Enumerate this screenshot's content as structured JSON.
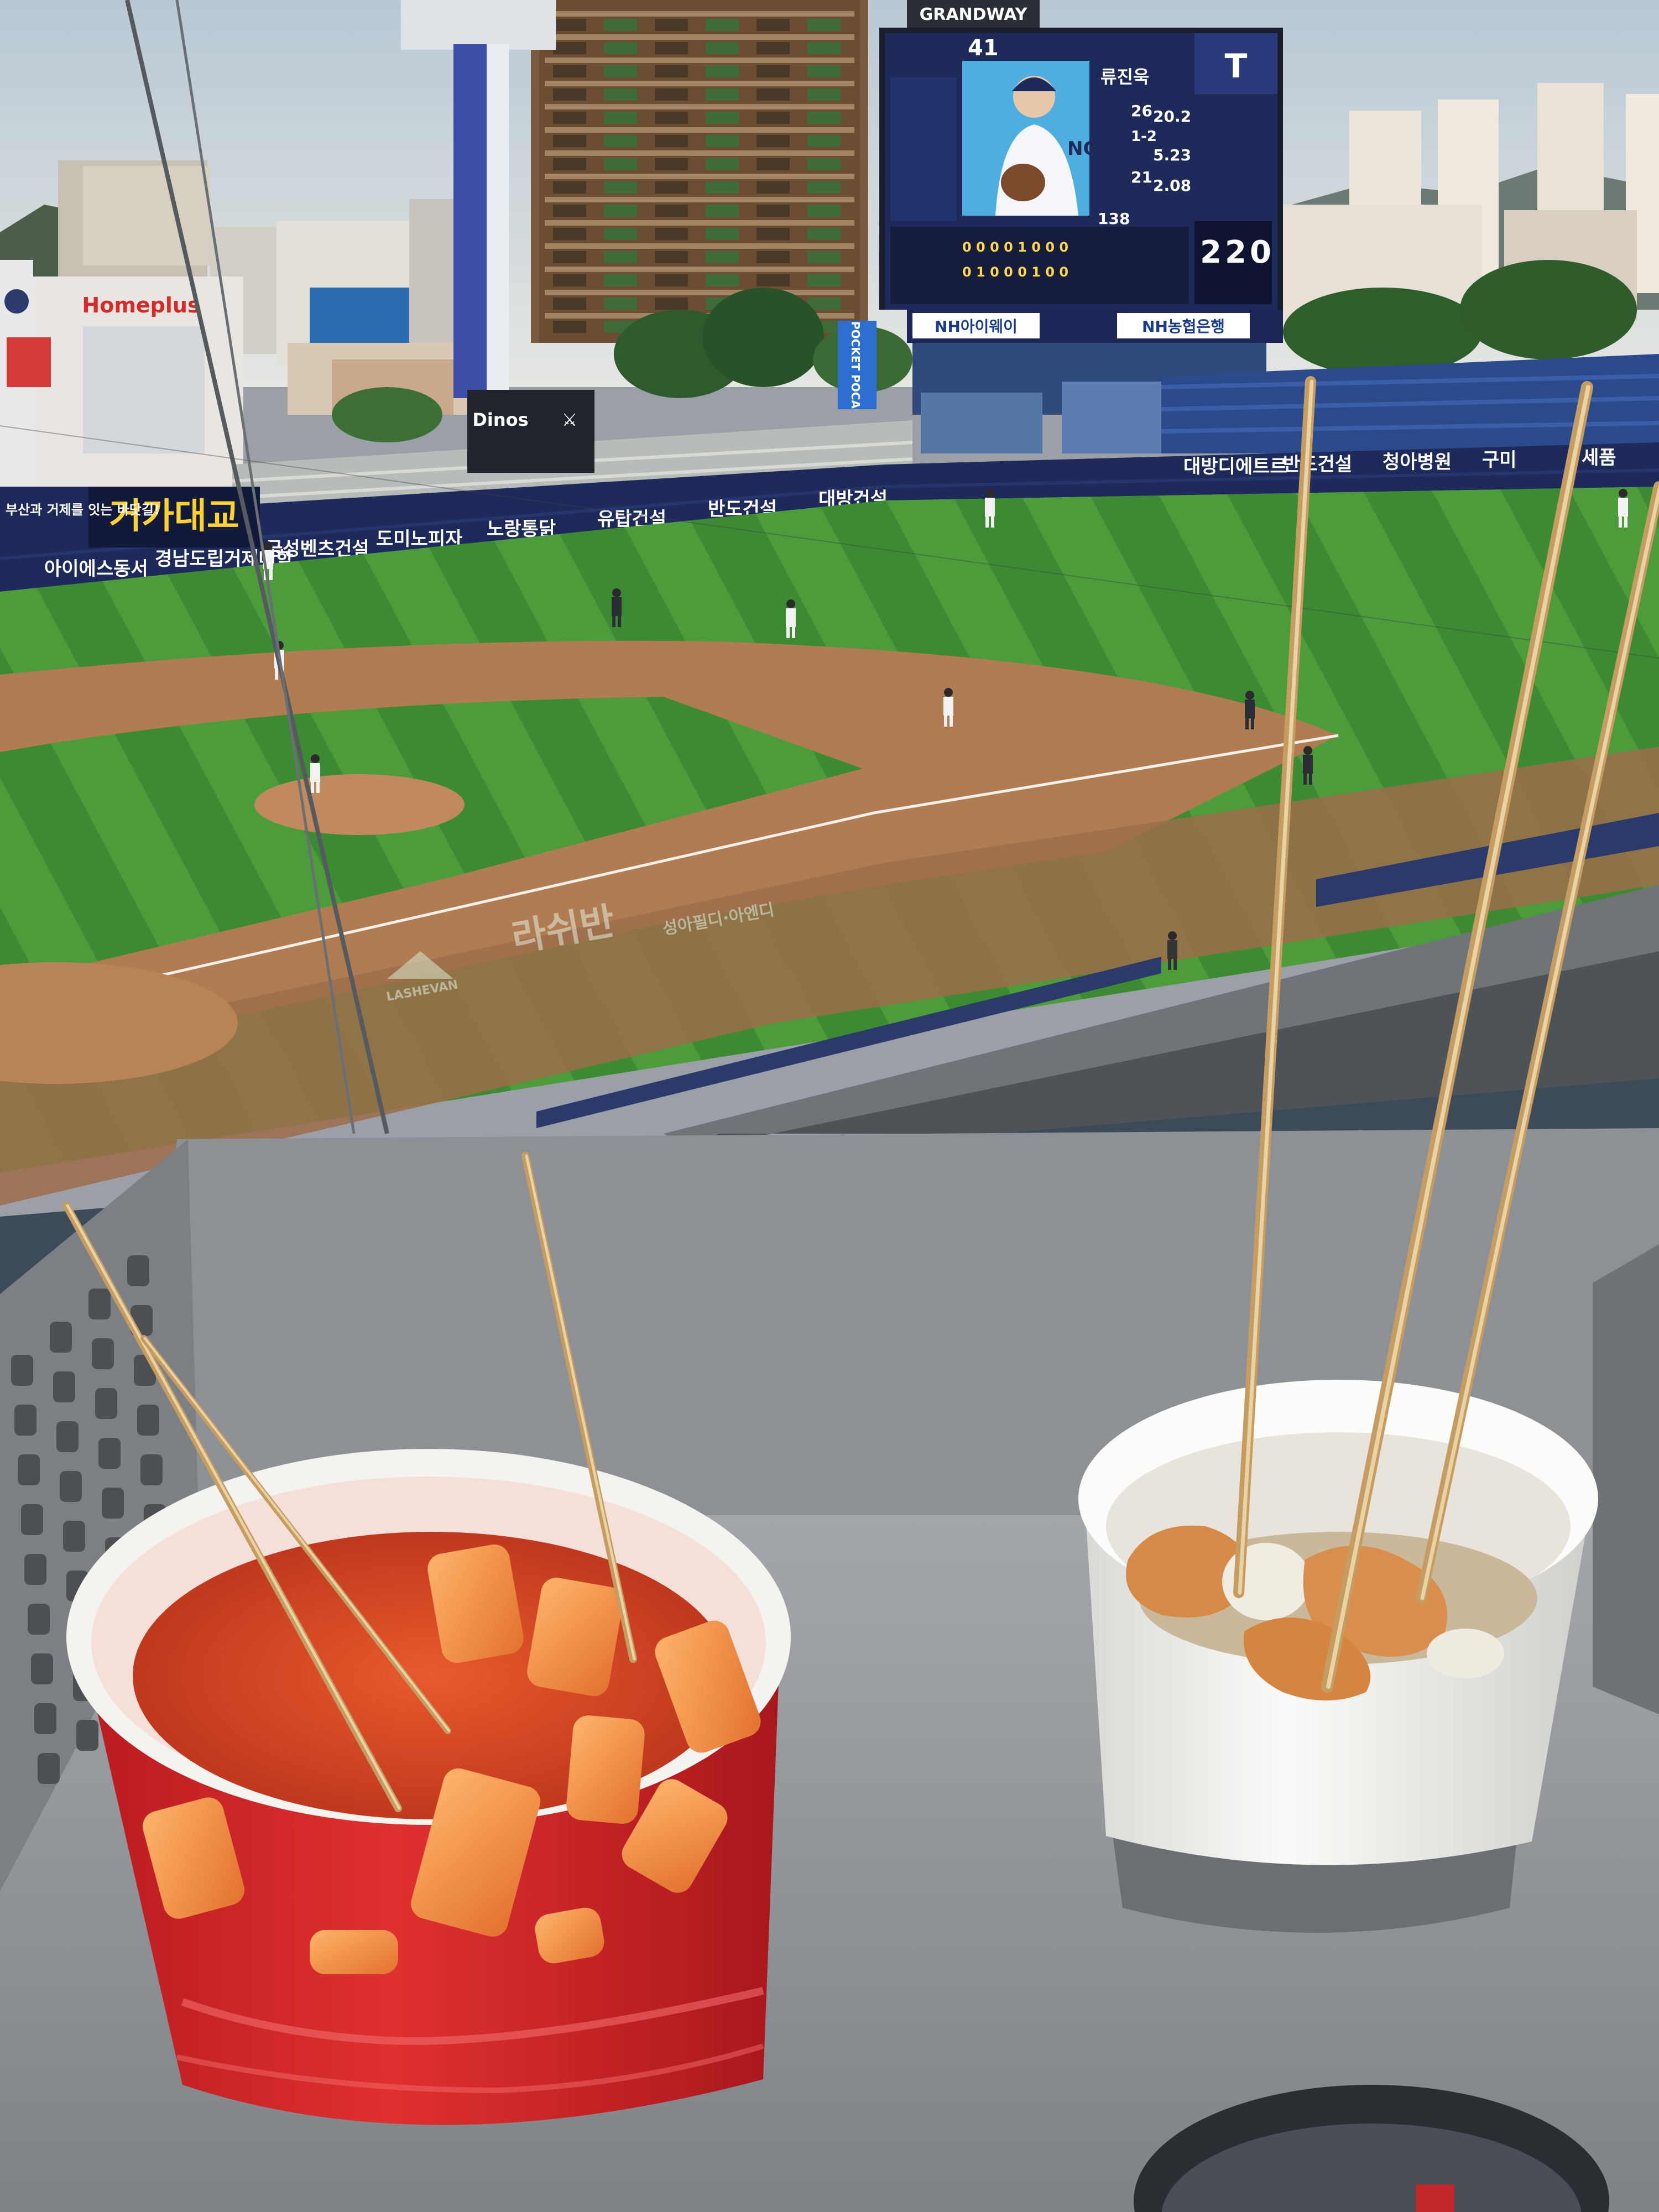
{
  "scoreboard": {
    "brand": "GRANDWAY",
    "player_number": "41",
    "player_name": "류진욱",
    "stat_a": "26",
    "stat_b": "20.2",
    "stat_c": "1-2",
    "stat_d": "5.23",
    "stat_e": "21",
    "stat_f": "2.08",
    "pitch_count": "138",
    "score_away": "2",
    "score_home": "2",
    "score_extra": "0",
    "sponsor_left": "NH아이웨이",
    "sponsor_right": "NH농협은행"
  },
  "stadium_ads": {
    "left_building": "Homeplus",
    "left_board": "거가대교",
    "left_board_sub": "부산과 거제를 잇는 바닷길!",
    "wall": [
      "아이에스동서",
      "경남도립거제대학",
      "금성벤츠건설",
      "도미노피자",
      "노랑통닭",
      "유탑건설",
      "반도건설",
      "대방건설"
    ],
    "dinos_sign": "Dinos",
    "right_wall": [
      "대방디에트르",
      "반도건설",
      "청아병원",
      "구미",
      "세품"
    ],
    "field_logo_main": "라쉬반",
    "field_logo_sub": "성아필디·아엔디",
    "field_logo_brand": "LASHEVAN",
    "banner_pole": "POCKET POCA"
  },
  "colors": {
    "sky": "#c9d4dc",
    "grass_light": "#4a9a3a",
    "grass_dark": "#3a8430",
    "dirt": "#b07a50",
    "scoreboard_bg": "#1d2a5a",
    "tray": "#8e9296",
    "tteokbokki_cup": "#d9252a",
    "sauce": "#d84a26",
    "odeng_cup": "#f2f2f0"
  },
  "icons": [
    "nc-dinos-logo",
    "fruit-ci-logo"
  ]
}
